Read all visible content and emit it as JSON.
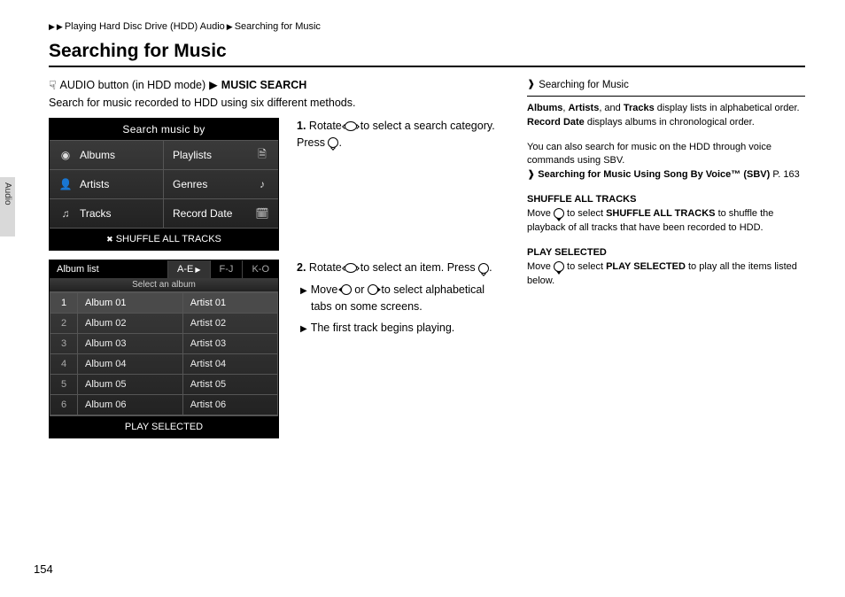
{
  "breadcrumb": {
    "part1": "Playing Hard Disc Drive (HDD) Audio",
    "part2": "Searching for Music"
  },
  "heading": "Searching for Music",
  "cmdline": {
    "pre": "AUDIO button (in HDD mode)",
    "bold": "MUSIC SEARCH"
  },
  "intro": "Search for music recorded to HDD using six different methods.",
  "step1": {
    "num": "1.",
    "text_a": "Rotate",
    "text_b": "to select a search category. Press",
    "text_c": "."
  },
  "step2": {
    "num": "2.",
    "text_a": "Rotate",
    "text_b": "to select an item. Press",
    "text_c": ".",
    "sub1_a": "Move",
    "sub1_b": "or",
    "sub1_c": "to select alphabetical tabs on some screens.",
    "sub2": "The first track begins playing."
  },
  "shot1": {
    "title": "Search music by",
    "cells": [
      "Albums",
      "Playlists",
      "Artists",
      "Genres",
      "Tracks",
      "Record Date"
    ],
    "footer": "SHUFFLE ALL TRACKS"
  },
  "shot2": {
    "title": "Album list",
    "tabs": [
      "A-E",
      "F-J",
      "K-O"
    ],
    "hint": "Select an album",
    "rows": [
      {
        "n": "1",
        "a": "Album 01",
        "r": "Artist 01"
      },
      {
        "n": "2",
        "a": "Album 02",
        "r": "Artist 02"
      },
      {
        "n": "3",
        "a": "Album 03",
        "r": "Artist 03"
      },
      {
        "n": "4",
        "a": "Album 04",
        "r": "Artist 04"
      },
      {
        "n": "5",
        "a": "Album 05",
        "r": "Artist 05"
      },
      {
        "n": "6",
        "a": "Album 06",
        "r": "Artist 06"
      }
    ],
    "footer": "PLAY SELECTED"
  },
  "right": {
    "head": "Searching for Music",
    "p1_a": "Albums",
    "p1_b": ", ",
    "p1_c": "Artists",
    "p1_d": ", and ",
    "p1_e": "Tracks",
    "p1_f": " display lists in alphabetical order. ",
    "p1_g": "Record Date",
    "p1_h": " displays albums in chronological order.",
    "p2": "You can also search for music on the HDD through voice commands using SBV.",
    "p2_link": "Searching for Music Using Song By Voice™ (SBV)",
    "p2_page": "P. 163",
    "sh_head": "SHUFFLE ALL TRACKS",
    "sh_a": "Move",
    "sh_b": "to select",
    "sh_c": "SHUFFLE ALL TRACKS",
    "sh_d": "to shuffle the playback of all tracks that have been recorded to HDD.",
    "ps_head": "PLAY SELECTED",
    "ps_a": "Move",
    "ps_b": "to select",
    "ps_c": "PLAY SELECTED",
    "ps_d": "to play all the items listed below."
  },
  "side_tab": "Audio",
  "page_num": "154"
}
